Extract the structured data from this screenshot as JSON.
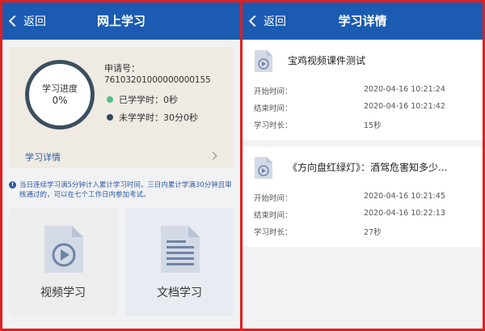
{
  "left": {
    "nav": {
      "back_label": "返回",
      "title": "网上学习"
    },
    "progress": {
      "ring_label": "学习进度",
      "ring_value": "0%",
      "application_label": "申请号：",
      "application_number": "76103201000000000155",
      "studied_label": "已学学时：0秒",
      "remaining_label": "未学学时：30分0秒",
      "detail_link": "学习详情"
    },
    "notice": "当日连续学习满5分钟计入累计学习时间，三日内累计学满30分钟且审核通过的，可以在七个工作日内参加考试。",
    "tiles": [
      {
        "label": "视频学习",
        "icon": "video-file-icon"
      },
      {
        "label": "文档学习",
        "icon": "document-file-icon"
      }
    ]
  },
  "right": {
    "nav": {
      "back_label": "返回",
      "title": "学习详情"
    },
    "records": [
      {
        "title": "宝鸡视频课件测试",
        "start_label": "开始时间：",
        "start_value": "2020-04-16 10:21:24",
        "end_label": "结束时间：",
        "end_value": "2020-04-16 10:21:42",
        "duration_label": "学习时长：",
        "duration_value": "15秒"
      },
      {
        "title": "《方向盘红绿灯》：酒驾危害知多少...",
        "start_label": "开始时间：",
        "start_value": "2020-04-16 10:21:45",
        "end_label": "结束时间：",
        "end_value": "2020-04-16 10:22:13",
        "duration_label": "学习时长：",
        "duration_value": "27秒"
      }
    ]
  },
  "colors": {
    "nav_blue": "#1b5bb2",
    "ring": "#3b4f60",
    "green_dot": "#4fbf8a",
    "link_blue": "#2b5aa0",
    "frame_red": "#e11f1f"
  }
}
